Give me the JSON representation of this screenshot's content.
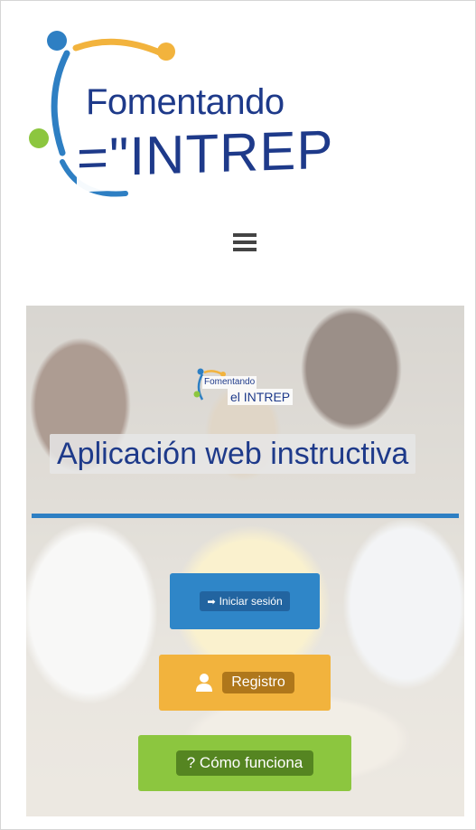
{
  "header": {
    "logo_line1": "Fomentando",
    "logo_line2": "=\"INTREP"
  },
  "nav": {
    "menu_icon": "hamburger-menu-icon"
  },
  "hero": {
    "mini_logo_line1": "Fomentando",
    "mini_logo_line2": "el INTREP",
    "title": "Aplicación web instructiva",
    "buttons": {
      "login": {
        "icon": "sign-in-icon",
        "label": "Iniciar sesión"
      },
      "register": {
        "icon": "user-icon",
        "label": "Registro"
      },
      "how": {
        "label": "? Cómo funciona"
      }
    }
  },
  "colors": {
    "brand_blue": "#1e3a8a",
    "login_blue": "#2f86c8",
    "register_orange": "#f2b33d",
    "how_green": "#8cc63f",
    "rule_blue": "#2e7fc3"
  }
}
